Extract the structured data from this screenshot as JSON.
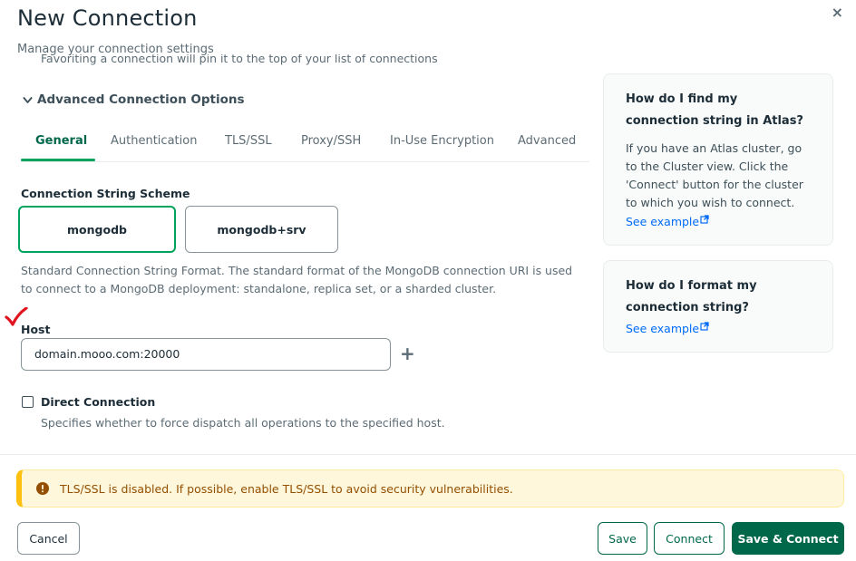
{
  "header": {
    "title": "New Connection",
    "subtitle": "Manage your connection settings",
    "clipped_text": "Favoriting a connection will pin it to the top of your list of connections",
    "close_label": "×"
  },
  "advanced": {
    "label": "Advanced Connection Options"
  },
  "tabs": [
    {
      "label": "General",
      "active": true
    },
    {
      "label": "Authentication",
      "active": false
    },
    {
      "label": "TLS/SSL",
      "active": false
    },
    {
      "label": "Proxy/SSH",
      "active": false
    },
    {
      "label": "In-Use Encryption",
      "active": false
    },
    {
      "label": "Advanced",
      "active": false
    }
  ],
  "scheme": {
    "label": "Connection String Scheme",
    "options": [
      "mongodb",
      "mongodb+srv"
    ],
    "selected": "mongodb",
    "description": "Standard Connection String Format. The standard format of the MongoDB connection URI is used to connect to a MongoDB deployment: standalone, replica set, or a sharded cluster."
  },
  "host": {
    "label": "Host",
    "value": "domain.mooo.com:20000",
    "add_label": "+"
  },
  "direct_connection": {
    "label": "Direct Connection",
    "checked": false,
    "description": "Specifies whether to force dispatch all operations to the specified host."
  },
  "help_cards": [
    {
      "title": "How do I find my connection string in Atlas?",
      "body": "If you have an Atlas cluster, go to the Cluster view. Click the 'Connect' button for the cluster to which you wish to connect.",
      "link": "See example"
    },
    {
      "title": "How do I format my connection string?",
      "link": "See example"
    }
  ],
  "banner": {
    "text": "TLS/SSL is disabled. If possible, enable TLS/SSL to avoid security vulnerabilities."
  },
  "footer": {
    "cancel_label": "Cancel",
    "save_label": "Save",
    "connect_label": "Connect",
    "save_connect_label": "Save & Connect"
  },
  "colors": {
    "accent": "#00a35c",
    "primary": "#00684a",
    "link": "#016bf8",
    "warning_bg": "#fef7db",
    "warning_text": "#944f01",
    "annotation_check": "#e0141e"
  }
}
